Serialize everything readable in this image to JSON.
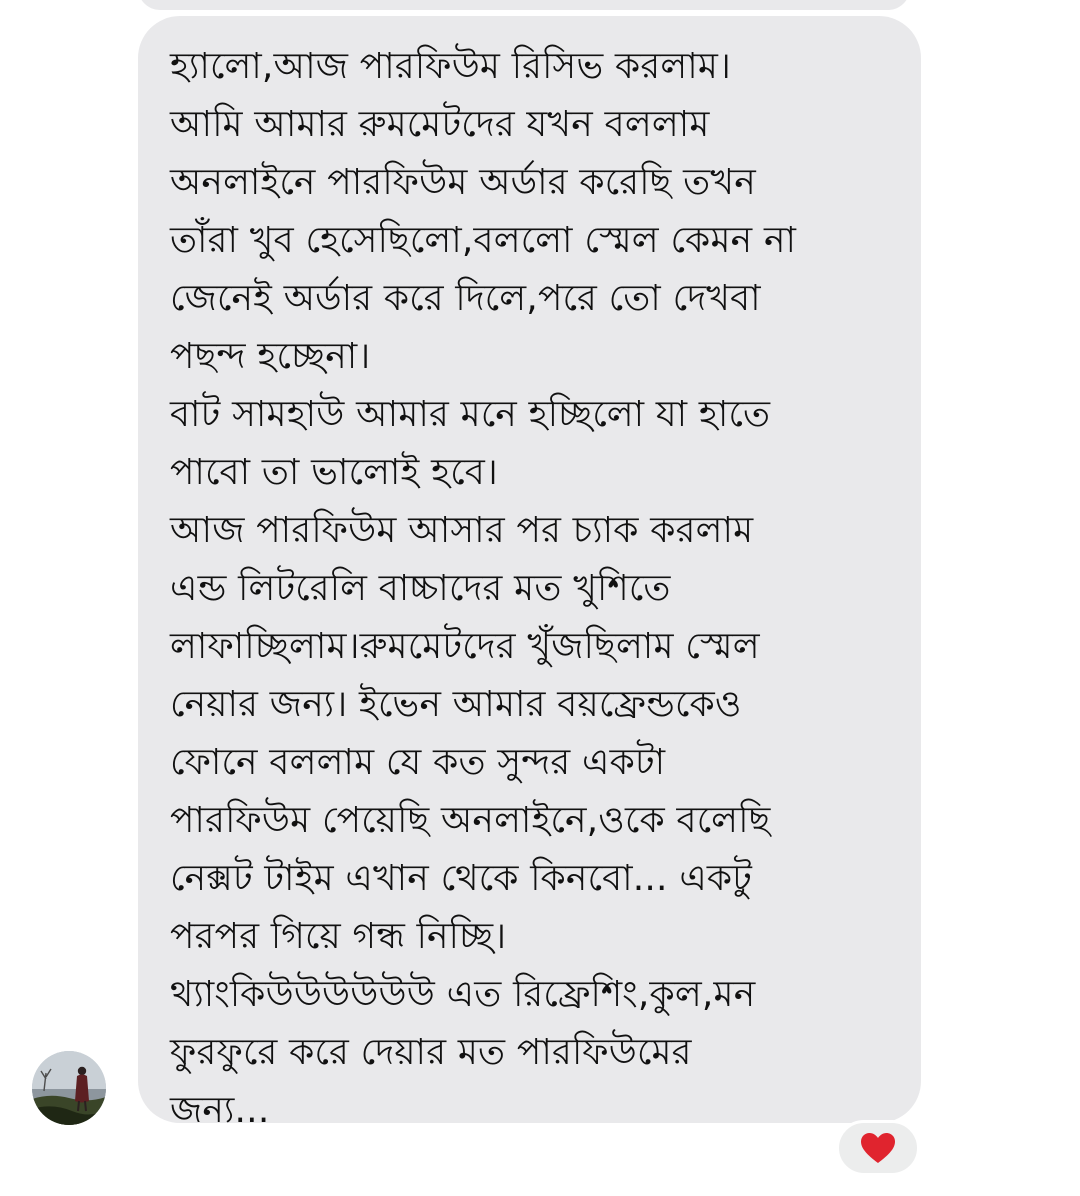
{
  "conversation": {
    "message": {
      "lines": [
        "হ্যালো,আজ পারফিউম রিসিভ করলাম।",
        "আমি আমার রুমমেটদের যখন বললাম",
        "অনলাইনে পারফিউম অর্ডার করেছি তখন",
        "তাঁরা খুব হেসেছিলো,বললো স্মেল কেমন না",
        "জেনেই অর্ডার করে দিলে,পরে তো দেখবা",
        "পছন্দ হচ্ছেনা।",
        "বাট সামহাউ আমার মনে হচ্ছিলো যা হাতে",
        "পাবো তা ভালোই হবে।",
        "আজ পারফিউম আসার পর চ্যাক করলাম",
        "এন্ড লিটরেলি বাচ্চাদের মত খুশিতে",
        "লাফাচ্ছিলাম।রুমমেটদের খুঁজছিলাম স্মেল",
        "নেয়ার জন্য। ইভেন আমার বয়ফ্রেন্ডকেও",
        "ফোনে বললাম যে কত সুন্দর একটা",
        "পারফিউম পেয়েছি অনলাইনে,ওকে বলেছি",
        "নেক্সট টাইম এখান থেকে কিনবো... একটু",
        "পরপর গিয়ে গন্ধ নিচ্ছি।",
        "থ্যাংকিউউউউউউ এত রিফ্রেশিং,কুল,মন",
        "ফুরফুরে করে দেয়ার মত পারফিউমের",
        "জন্য..."
      ],
      "reaction": {
        "icon": "heart-icon",
        "color": "#e0242e"
      }
    },
    "sender": {
      "avatar_icon": "profile-avatar"
    },
    "colors": {
      "bubble_background": "#e9e9eb",
      "page_background": "#ffffff",
      "text": "#111111"
    }
  }
}
